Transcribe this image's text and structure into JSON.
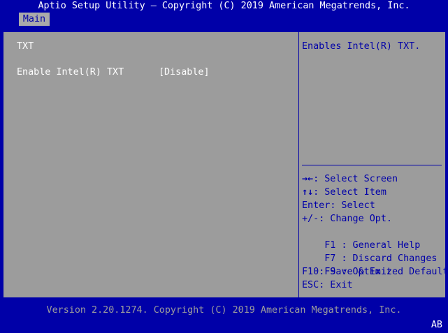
{
  "header": {
    "title": "Aptio Setup Utility – Copyright (C) 2019 American Megatrends, Inc."
  },
  "tabs": [
    {
      "label": "Main"
    }
  ],
  "main": {
    "section_title": "TXT",
    "settings": [
      {
        "label": "Enable Intel(R) TXT",
        "value": "[Disable]"
      }
    ]
  },
  "help": {
    "description": "Enables Intel(R) TXT.",
    "keys": [
      {
        "key": "→←",
        "action": ": Select Screen",
        "symbol": true
      },
      {
        "key": "↑↓",
        "action": ": Select Item",
        "symbol": true
      },
      {
        "key": "Enter",
        "action": ": Select"
      },
      {
        "key": "+/-",
        "action": ": Change Opt."
      },
      {
        "key": "F1 ",
        "action": ": General Help"
      },
      {
        "key": "F7 ",
        "action": ": Discard Changes"
      },
      {
        "key": "F9 ",
        "action": ": Optimized Defaults"
      },
      {
        "key": "F10",
        "action": ": Save & Exit"
      },
      {
        "key": "ESC",
        "action": ": Exit"
      }
    ]
  },
  "footer": {
    "version": "Version 2.20.1274. Copyright (C) 2019 American Megatrends, Inc.",
    "corner": "AB"
  },
  "colors": {
    "background_blue": "#0000a8",
    "panel_gray": "#9c9c9c",
    "tab_gray": "#aaaaaa",
    "text_white": "#ffffff",
    "help_blue": "#0000a8"
  }
}
